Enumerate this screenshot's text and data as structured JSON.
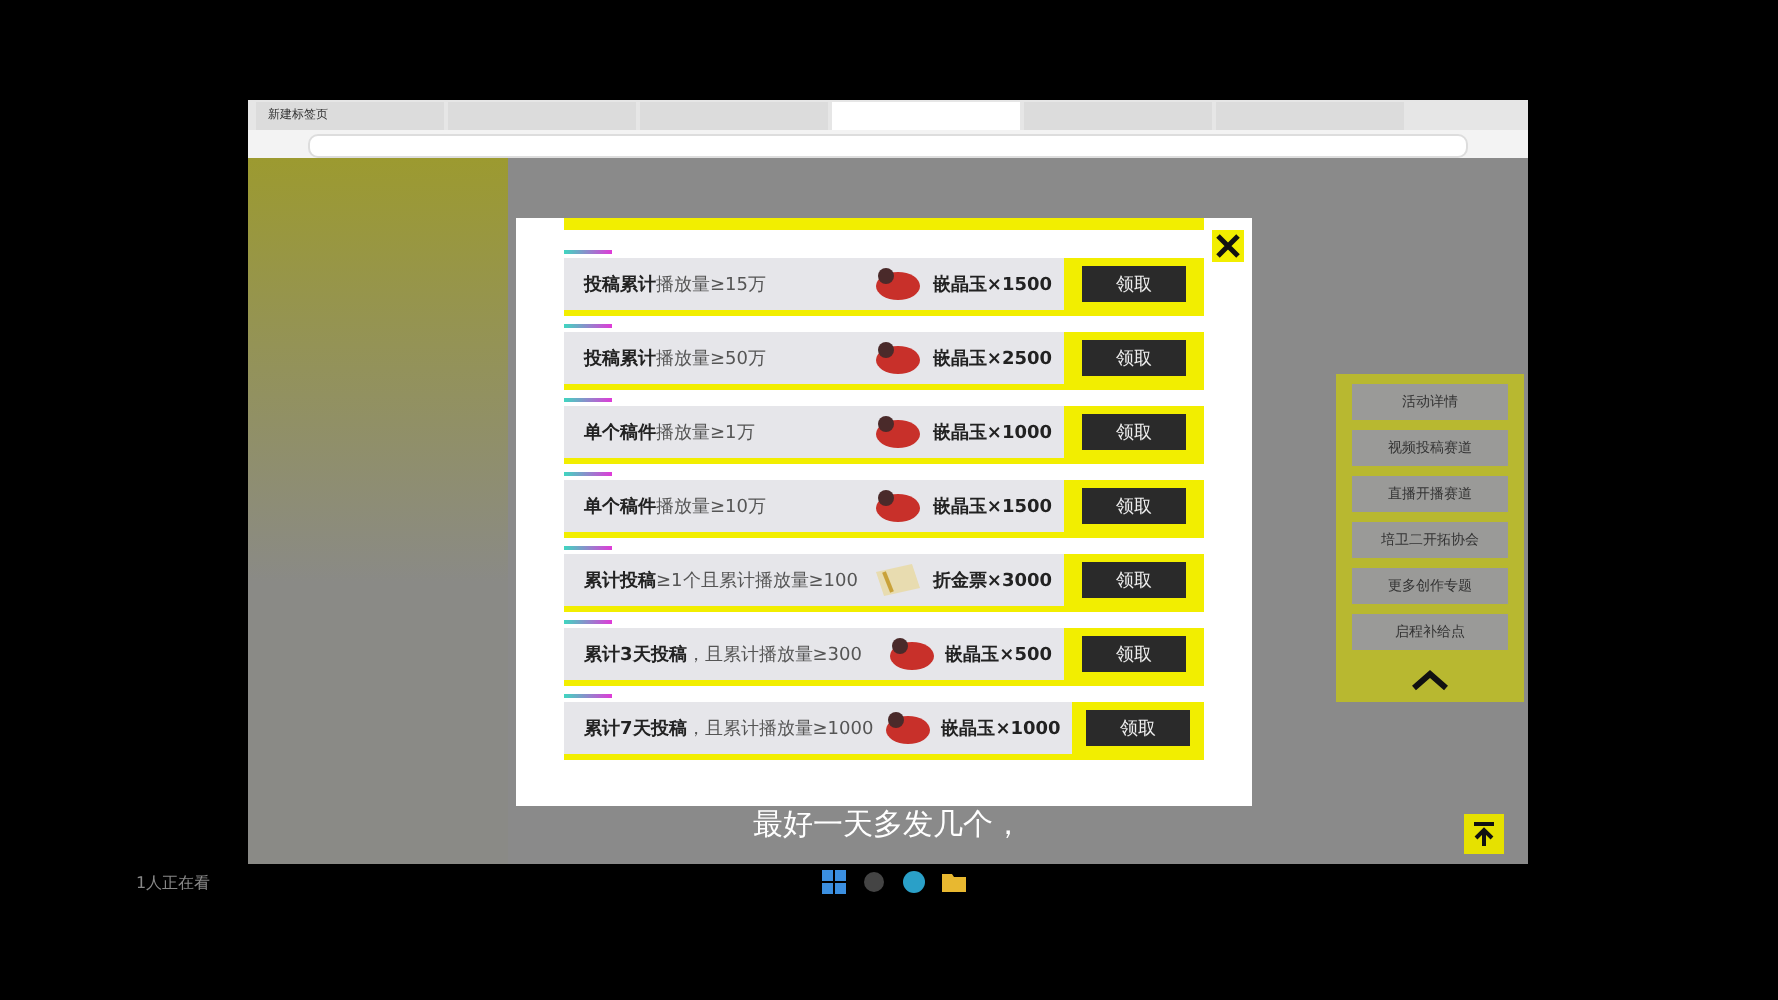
{
  "browser": {
    "tabs": [
      {
        "label": "新建标签页",
        "selected": false
      },
      {
        "selected": false
      },
      {
        "selected": false
      },
      {
        "selected": true
      },
      {
        "selected": false
      },
      {
        "selected": false
      }
    ]
  },
  "side_menu": {
    "items": [
      "活动详情",
      "视频投稿赛道",
      "直播开播赛道",
      "培卫二开拓协会",
      "更多创作专题",
      "启程补给点"
    ]
  },
  "modal": {
    "tasks": [
      {
        "requirement": "**投稿累计**播放量≥15万",
        "kind": "gem",
        "reward": "嵌晶玉×1500",
        "button": "领取"
      },
      {
        "requirement": "**投稿累计**播放量≥50万",
        "kind": "gem",
        "reward": "嵌晶玉×2500",
        "button": "领取"
      },
      {
        "requirement": "**单个稿件**播放量≥1万",
        "kind": "gem",
        "reward": "嵌晶玉×1000",
        "button": "领取"
      },
      {
        "requirement": "**单个稿件**播放量≥10万",
        "kind": "gem",
        "reward": "嵌晶玉×1500",
        "button": "领取"
      },
      {
        "requirement": "**累计投稿**≥1个且累计播放量≥100",
        "kind": "ticket",
        "reward": "折金票×3000",
        "button": "领取"
      },
      {
        "requirement": "**累计3天投稿**，且累计播放量≥300",
        "kind": "gem",
        "reward": "嵌晶玉×500",
        "button": "领取"
      },
      {
        "requirement": "**累计7天投稿**，且累计播放量≥1000",
        "kind": "gem",
        "reward": "嵌晶玉×1000",
        "button": "领取"
      }
    ]
  },
  "subtitle": "最好一天多发几个，",
  "viewers": "1人正在看"
}
